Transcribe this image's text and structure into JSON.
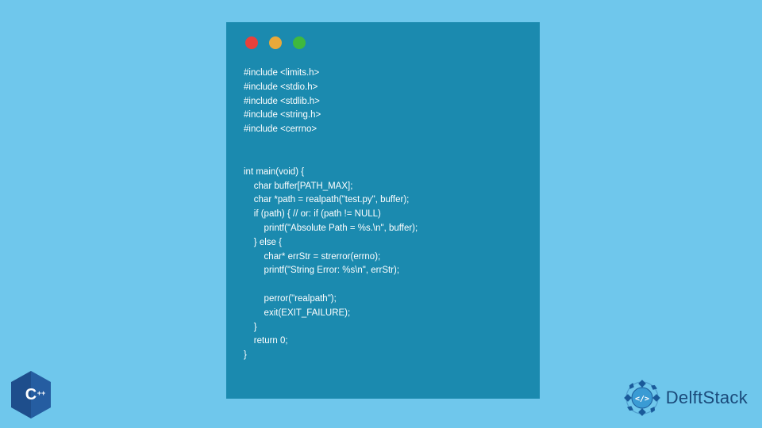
{
  "code": {
    "lines": [
      "#include <limits.h>",
      "#include <stdio.h>",
      "#include <stdlib.h>",
      "#include <string.h>",
      "#include <cerrno>",
      "",
      "",
      "int main(void) {",
      "    char buffer[PATH_MAX];",
      "    char *path = realpath(\"test.py\", buffer);",
      "    if (path) { // or: if (path != NULL)",
      "        printf(\"Absolute Path = %s.\\n\", buffer);",
      "    } else {",
      "        char* errStr = strerror(errno);",
      "        printf(\"String Error: %s\\n\", errStr);",
      "",
      "        perror(\"realpath\");",
      "        exit(EXIT_FAILURE);",
      "    }",
      "    return 0;",
      "}"
    ]
  },
  "branding": {
    "cpp_label": "C++",
    "site_name": "DelftStack"
  },
  "colors": {
    "page_bg": "#6fc7ec",
    "window_bg": "#1b8aaf",
    "red": "#e8413c",
    "yellow": "#e9a93a",
    "green": "#3fb83f",
    "cpp_blue": "#1e4e8c",
    "delft_blue": "#1a4a7a"
  }
}
